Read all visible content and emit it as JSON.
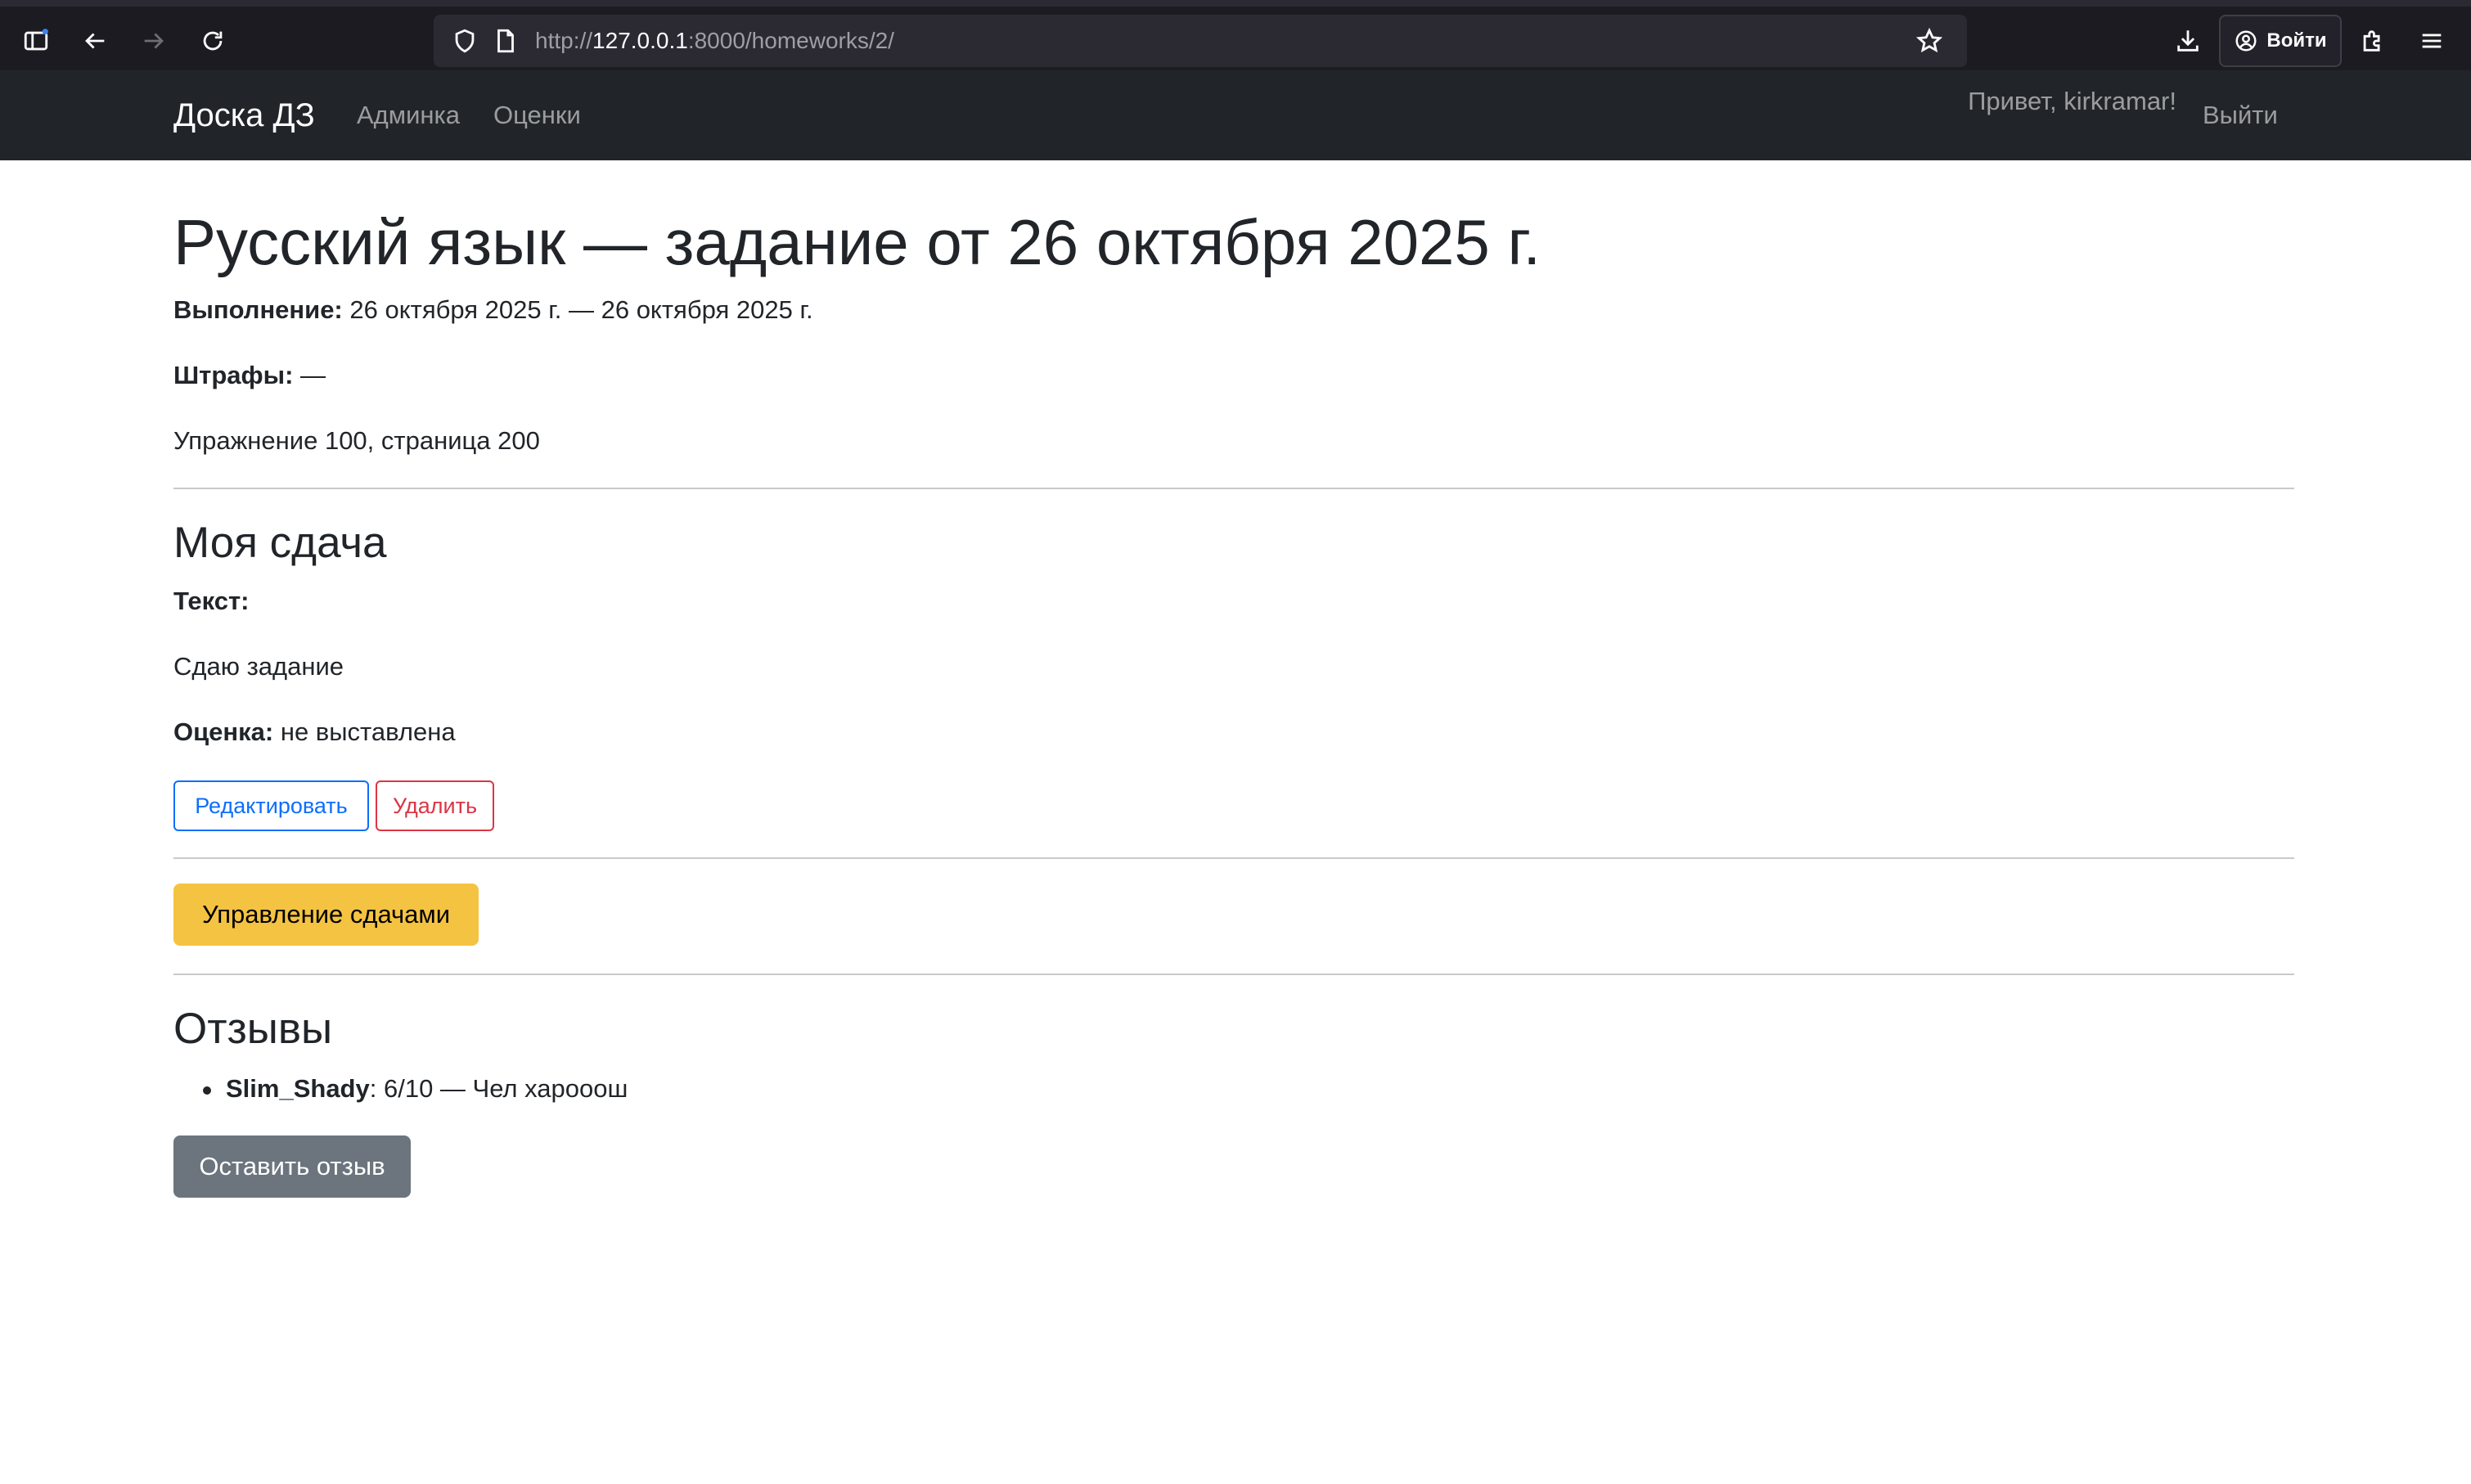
{
  "browser": {
    "url_prefix": "http://",
    "url_host": "127.0.0.1",
    "url_rest": ":8000/homeworks/2/",
    "login_label": "Войти"
  },
  "navbar": {
    "brand": "Доска ДЗ",
    "links": [
      "Админка",
      "Оценки"
    ],
    "greeting": "Привет, kirkramar!",
    "logout": "Выйти",
    "bg_color": "#212529"
  },
  "homework": {
    "title": "Русский язык — задание от 26 октября 2025 г.",
    "period_label": "Выполнение:",
    "period_value": " 26 октября 2025 г. — 26 октября 2025 г.",
    "penalties_label": "Штрафы:",
    "penalties_value": " —",
    "description": "Упражнение 100, страница 200"
  },
  "submission": {
    "heading": "Моя сдача",
    "text_label": "Текст:",
    "text_value": "Сдаю задание",
    "grade_label": "Оценка:",
    "grade_value": " не выставлена",
    "edit_button": "Редактировать",
    "delete_button": "Удалить"
  },
  "manage": {
    "button": "Управление сдачами",
    "color": "#f5c342"
  },
  "reviews": {
    "heading": "Отзывы",
    "items": [
      {
        "author": "Slim_Shady",
        "rest": ": 6/10 — Чел харооош"
      }
    ],
    "leave_button": "Оставить отзыв"
  }
}
